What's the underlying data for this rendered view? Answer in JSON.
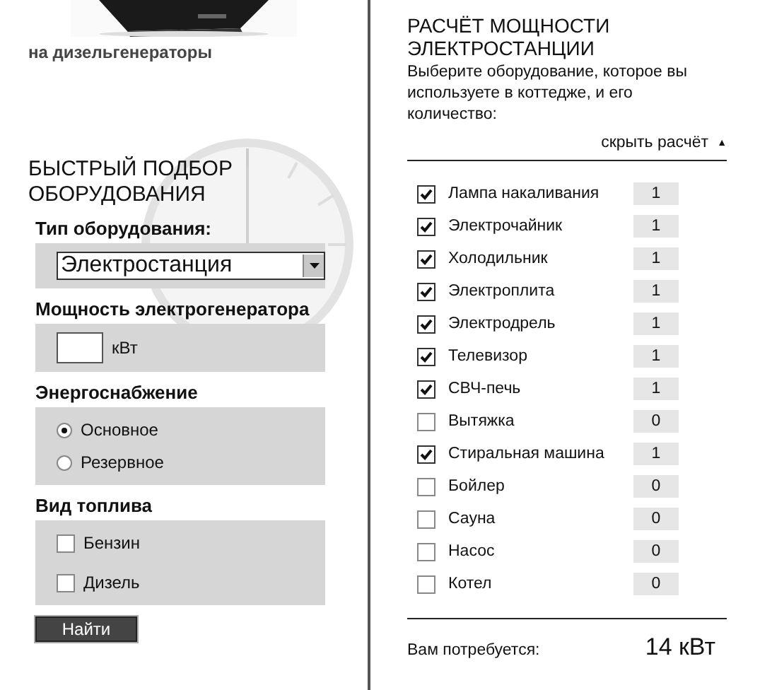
{
  "promo": {
    "caption": "на дизельгенераторы"
  },
  "quick_select": {
    "title": "БЫСТРЫЙ ПОДБОР ОБОРУДОВАНИЯ",
    "equipment_type": {
      "label": "Тип оборудования:",
      "value": "Электростанция"
    },
    "power": {
      "label": "Мощность электрогенератора",
      "unit": "кВт"
    },
    "supply": {
      "label": "Энергоснабжение",
      "options": [
        {
          "label": "Основное",
          "selected": true
        },
        {
          "label": "Резервное",
          "selected": false
        }
      ]
    },
    "fuel": {
      "label": "Вид топлива",
      "options": [
        {
          "label": "Бензин",
          "checked": false
        },
        {
          "label": "Дизель",
          "checked": false
        }
      ]
    },
    "button": "Найти"
  },
  "calculator": {
    "title": "РАСЧЁТ МОЩНОСТИ ЭЛЕКТРОСТАНЦИИ",
    "description": "Выберите оборудование, которое вы используете в коттедже, и его количество:",
    "toggle": "скрыть расчёт",
    "toggle_icon": "▲",
    "items": [
      {
        "label": "Лампа накаливания",
        "checked": true,
        "count": "1"
      },
      {
        "label": "Электрочайник",
        "checked": true,
        "count": "1"
      },
      {
        "label": "Холодильник",
        "checked": true,
        "count": "1"
      },
      {
        "label": "Электроплита",
        "checked": true,
        "count": "1"
      },
      {
        "label": "Электродрель",
        "checked": true,
        "count": "1"
      },
      {
        "label": "Телевизор",
        "checked": true,
        "count": "1"
      },
      {
        "label": "СВЧ-печь",
        "checked": true,
        "count": "1"
      },
      {
        "label": "Вытяжка",
        "checked": false,
        "count": "0"
      },
      {
        "label": "Стиральная машина",
        "checked": true,
        "count": "1"
      },
      {
        "label": "Бойлер",
        "checked": false,
        "count": "0"
      },
      {
        "label": "Сауна",
        "checked": false,
        "count": "0"
      },
      {
        "label": "Насос",
        "checked": false,
        "count": "0"
      },
      {
        "label": "Котел",
        "checked": false,
        "count": "0"
      }
    ],
    "result_label": "Вам потребуется:",
    "result_value": "14 кВт"
  }
}
